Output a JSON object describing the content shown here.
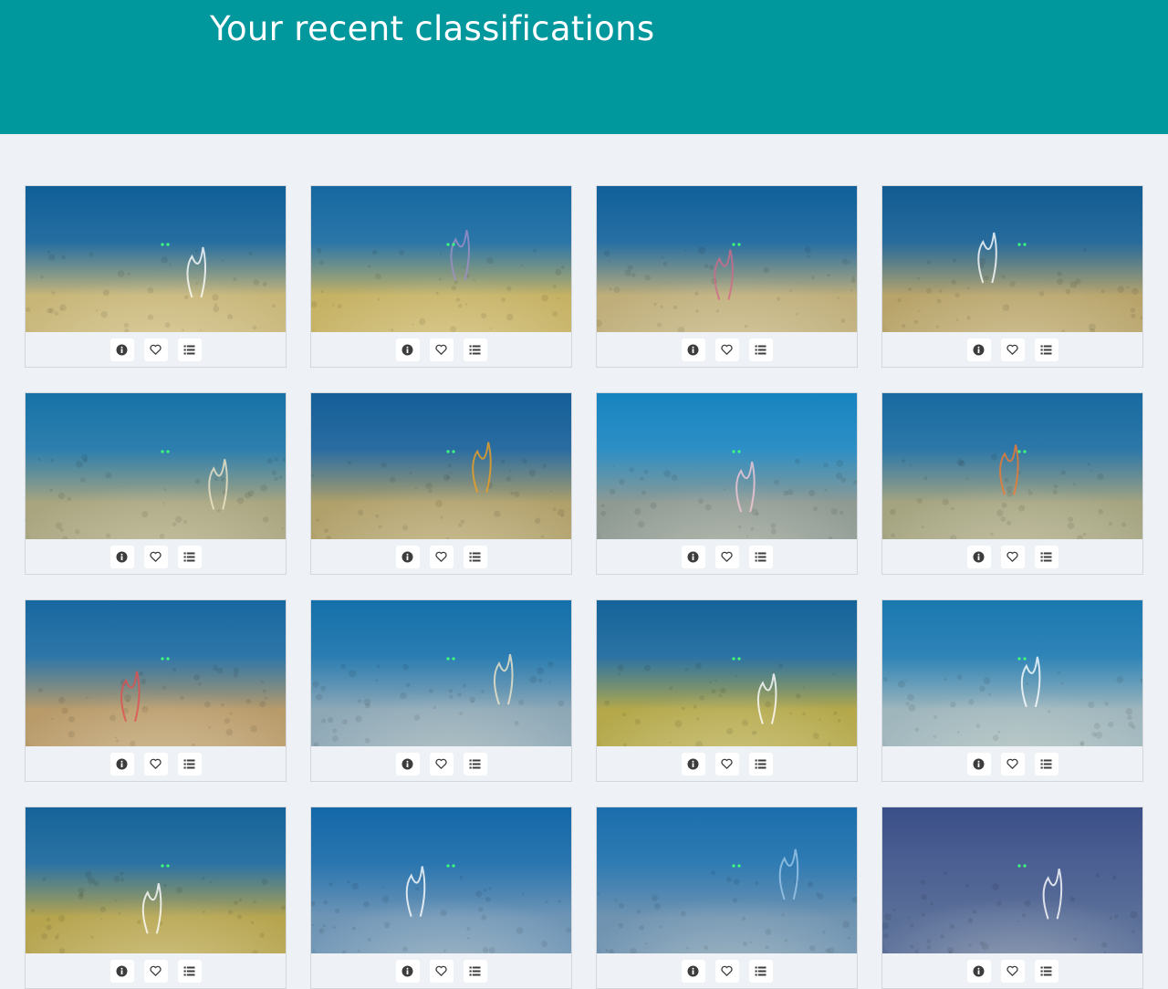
{
  "page": {
    "title": "Your recent classifications"
  },
  "colors": {
    "header_bg": "#00979d",
    "page_bg": "#eef1f5",
    "card_border": "#d3d7dc"
  },
  "card_actions": [
    {
      "name": "info-button",
      "icon": "info-icon"
    },
    {
      "name": "favorite-button",
      "icon": "heart-icon"
    },
    {
      "name": "collections-button",
      "icon": "list-icon"
    }
  ],
  "classifications": [
    {
      "scene": "seafloor-gorgonians-camera-housing",
      "tint": "#c8b678",
      "top": "#0f5f98",
      "accent": "#ffffff"
    },
    {
      "scene": "seafloor-yellow-coral-purple-fan",
      "tint": "#c6b264",
      "top": "#1568a0",
      "accent": "#a08fc8"
    },
    {
      "scene": "seafloor-lasers-sand",
      "tint": "#bfae7a",
      "top": "#10609a",
      "accent": "#d06a8a"
    },
    {
      "scene": "seafloor-white-fan-camera-housing",
      "tint": "#b8a46a",
      "top": "#115c92",
      "accent": "#ffffff"
    },
    {
      "scene": "seafloor-wire-coral-sand",
      "tint": "#a9a57f",
      "top": "#1772a6",
      "accent": "#f0e6c8"
    },
    {
      "scene": "seafloor-orange-fan-camera",
      "tint": "#b0a06a",
      "top": "#145e98",
      "accent": "#f0a020"
    },
    {
      "scene": "seafloor-rock-wall-lasers",
      "tint": "#8f9a93",
      "top": "#1784c0",
      "accent": "#f4c8d8"
    },
    {
      "scene": "seafloor-orange-gorgonian",
      "tint": "#a5a480",
      "top": "#176aa0",
      "accent": "#f07a30"
    },
    {
      "scene": "seafloor-rock-mound-red-sponges",
      "tint": "#b99b6a",
      "top": "#1868a0",
      "accent": "#e05050"
    },
    {
      "scene": "seafloor-blue-sandy-plain",
      "tint": "#8ea8b6",
      "top": "#1470aa",
      "accent": "#f0e6c8"
    },
    {
      "scene": "seafloor-spiral-whips-yellow-coral",
      "tint": "#b4a84a",
      "top": "#15649a",
      "accent": "#ffffff"
    },
    {
      "scene": "seafloor-sand-marker-spiral",
      "tint": "#9fb6bc",
      "top": "#1a78b0",
      "accent": "#ffffff"
    },
    {
      "scene": "seafloor-spiral-whips",
      "tint": "#b6a44e",
      "top": "#15649a",
      "accent": "#ffffff"
    },
    {
      "scene": "seafloor-white-whip",
      "tint": "#6f95b5",
      "top": "#1468a8",
      "accent": "#ffffff"
    },
    {
      "scene": "seafloor-bright-rocks",
      "tint": "#6f93b0",
      "top": "#1a6eac",
      "accent": "#9ec8e8"
    },
    {
      "scene": "seafloor-dark-spiral",
      "tint": "#5a6f98",
      "top": "#3a4f88",
      "accent": "#ffffff"
    }
  ]
}
